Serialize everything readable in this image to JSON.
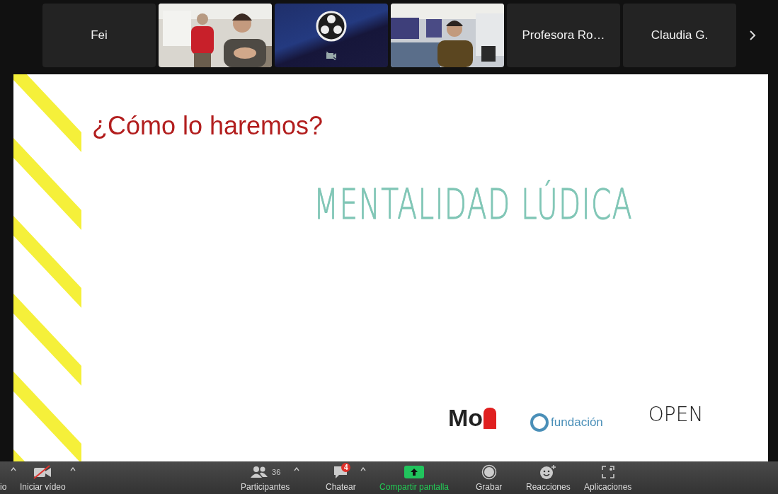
{
  "participants": [
    {
      "kind": "name",
      "name": "Fei"
    },
    {
      "kind": "video_pair"
    },
    {
      "kind": "muted_video"
    },
    {
      "kind": "video_single"
    },
    {
      "kind": "name",
      "name": "Profesora Ro…"
    },
    {
      "kind": "name",
      "name": "Claudia G."
    }
  ],
  "slide": {
    "title": "¿Cómo lo haremos?",
    "headline": "MENTALIDAD LÚDICA",
    "logos": [
      {
        "kind": "mo",
        "text": "Mo"
      },
      {
        "kind": "fundacion",
        "text": "fundación"
      },
      {
        "kind": "open",
        "text": "OPEN"
      }
    ]
  },
  "toolbar": [
    {
      "kind": "audio",
      "label": "io"
    },
    {
      "kind": "video",
      "label": "Iniciar vídeo"
    },
    {
      "kind": "participants",
      "label": "Participantes",
      "count": "36"
    },
    {
      "kind": "chat",
      "label": "Chatear",
      "badge": "4"
    },
    {
      "kind": "share",
      "label": "Compartir pantalla"
    },
    {
      "kind": "record",
      "label": "Grabar"
    },
    {
      "kind": "reactions",
      "label": "Reacciones"
    },
    {
      "kind": "apps",
      "label": "Aplicaciones"
    }
  ]
}
